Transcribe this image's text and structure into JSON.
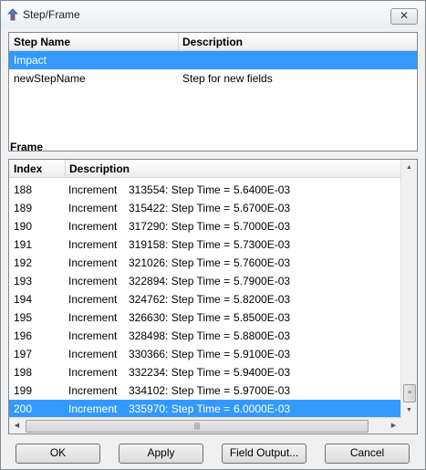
{
  "window": {
    "title": "Step/Frame",
    "close_glyph": "✕"
  },
  "steps": {
    "columns": [
      "Step Name",
      "Description"
    ],
    "rows": [
      {
        "name": "Impact",
        "description": "",
        "selected": true
      },
      {
        "name": "newStepName",
        "description": "Step for new fields",
        "selected": false
      }
    ]
  },
  "frame": {
    "label": "Frame",
    "columns": [
      "Index",
      "Description"
    ],
    "rows": [
      {
        "index": "188",
        "kind": "Increment",
        "inc": "313554: Step Time =",
        "time": "5.6400E-03"
      },
      {
        "index": "189",
        "kind": "Increment",
        "inc": "315422: Step Time =",
        "time": "5.6700E-03"
      },
      {
        "index": "190",
        "kind": "Increment",
        "inc": "317290: Step Time =",
        "time": "5.7000E-03"
      },
      {
        "index": "191",
        "kind": "Increment",
        "inc": "319158: Step Time =",
        "time": "5.7300E-03"
      },
      {
        "index": "192",
        "kind": "Increment",
        "inc": "321026: Step Time =",
        "time": "5.7600E-03"
      },
      {
        "index": "193",
        "kind": "Increment",
        "inc": "322894: Step Time =",
        "time": "5.7900E-03"
      },
      {
        "index": "194",
        "kind": "Increment",
        "inc": "324762: Step Time =",
        "time": "5.8200E-03"
      },
      {
        "index": "195",
        "kind": "Increment",
        "inc": "326630: Step Time =",
        "time": "5.8500E-03"
      },
      {
        "index": "196",
        "kind": "Increment",
        "inc": "328498: Step Time =",
        "time": "5.8800E-03"
      },
      {
        "index": "197",
        "kind": "Increment",
        "inc": "330366: Step Time =",
        "time": "5.9100E-03"
      },
      {
        "index": "198",
        "kind": "Increment",
        "inc": "332234: Step Time =",
        "time": "5.9400E-03"
      },
      {
        "index": "199",
        "kind": "Increment",
        "inc": "334102: Step Time =",
        "time": "5.9700E-03"
      },
      {
        "index": "200",
        "kind": "Increment",
        "inc": "335970: Step Time =",
        "time": "6.0000E-03",
        "selected": true
      }
    ]
  },
  "buttons": {
    "ok": "OK",
    "apply": "Apply",
    "field_output": "Field Output...",
    "cancel": "Cancel"
  },
  "colors": {
    "selection": "#3399ff"
  },
  "icons": {
    "app": "step-frame-icon",
    "close": "close-icon"
  }
}
